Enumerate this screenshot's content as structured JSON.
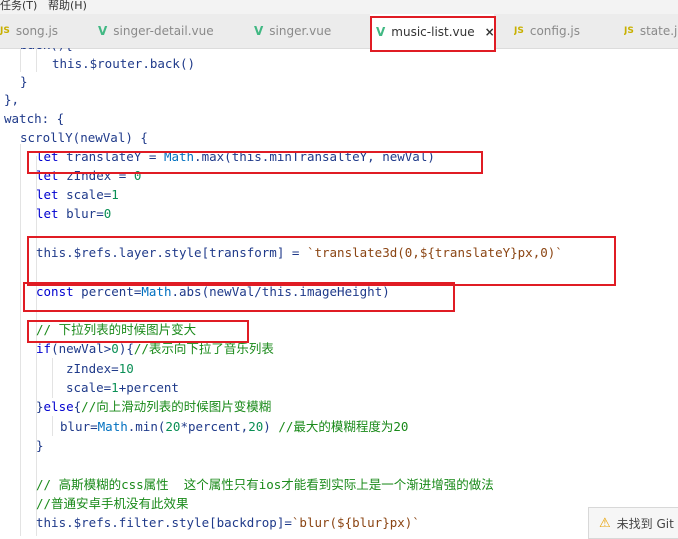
{
  "menu": {
    "items": [
      "任务(T)",
      "帮助(H)"
    ]
  },
  "tabs": [
    {
      "icon": "js-icon",
      "icon_text": "JS",
      "label": "song.js"
    },
    {
      "icon": "vue-icon",
      "icon_text": "V",
      "label": "singer-detail.vue"
    },
    {
      "icon": "vue-icon",
      "icon_text": "V",
      "label": "singer.vue"
    },
    {
      "icon": "vue-icon",
      "icon_text": "V",
      "label": "music-list.vue",
      "close": "×"
    },
    {
      "icon": "js-icon",
      "icon_text": "JS",
      "label": "config.js"
    },
    {
      "icon": "js-icon",
      "icon_text": "JS",
      "label": "state.js"
    }
  ],
  "code": {
    "lines": [
      [
        [
          "plain",
          "back(){"
        ]
      ],
      [
        [
          "plain",
          "this"
        ],
        [
          "plain",
          ".$router.back()"
        ]
      ],
      [
        [
          "plain",
          "}"
        ]
      ],
      [
        [
          "plain",
          "},"
        ]
      ],
      [
        [
          "plain",
          "watch: {"
        ]
      ],
      [
        [
          "plain",
          "scrollY(newVal) {"
        ]
      ],
      [
        [
          "kw",
          "let"
        ],
        [
          "plain",
          " translateY = "
        ],
        [
          "obj",
          "Math"
        ],
        [
          "plain",
          ".max("
        ],
        [
          "plain",
          "this"
        ],
        [
          "plain",
          ".minTransalteY, newVal)"
        ]
      ],
      [
        [
          "kw",
          "let"
        ],
        [
          "plain",
          " zIndex = "
        ],
        [
          "num",
          "0"
        ]
      ],
      [
        [
          "kw",
          "let"
        ],
        [
          "plain",
          " scale="
        ],
        [
          "num",
          "1"
        ]
      ],
      [
        [
          "kw",
          "let"
        ],
        [
          "plain",
          " blur="
        ],
        [
          "num",
          "0"
        ]
      ],
      [],
      [
        [
          "plain",
          "this"
        ],
        [
          "plain",
          ".$refs.layer.style[transform] = "
        ],
        [
          "str",
          "`translate3d(0,${translateY}px,0)`"
        ]
      ],
      [],
      [
        [
          "kw",
          "const"
        ],
        [
          "plain",
          " percent="
        ],
        [
          "obj",
          "Math"
        ],
        [
          "plain",
          ".abs(newVal/"
        ],
        [
          "plain",
          "this"
        ],
        [
          "plain",
          ".imageHeight)"
        ]
      ],
      [],
      [
        [
          "cm",
          "// 下拉列表的时候图片变大"
        ]
      ],
      [
        [
          "kw",
          "if"
        ],
        [
          "plain",
          "(newVal>"
        ],
        [
          "num",
          "0"
        ],
        [
          "plain",
          "){"
        ],
        [
          "cm",
          "//表示向下拉了音乐列表"
        ]
      ],
      [
        [
          "plain",
          "zIndex="
        ],
        [
          "num",
          "10"
        ]
      ],
      [
        [
          "plain",
          "scale="
        ],
        [
          "num",
          "1"
        ],
        [
          "plain",
          "+percent"
        ]
      ],
      [
        [
          "plain",
          "}"
        ],
        [
          "kw",
          "else"
        ],
        [
          "plain",
          "{"
        ],
        [
          "cm",
          "//向上滑动列表的时候图片变模糊"
        ]
      ],
      [
        [
          "plain",
          "blur="
        ],
        [
          "obj",
          "Math"
        ],
        [
          "plain",
          ".min("
        ],
        [
          "num",
          "20"
        ],
        [
          "plain",
          "*percent,"
        ],
        [
          "num",
          "20"
        ],
        [
          "plain",
          ") "
        ],
        [
          "cm",
          "//最大的模糊程度为20"
        ]
      ],
      [
        [
          "plain",
          "}"
        ]
      ],
      [],
      [
        [
          "cm",
          "// 高斯模糊的css属性  这个属性只有ios才能看到实际上是一个渐进增强的做法"
        ]
      ],
      [
        [
          "cm",
          "//普通安卓手机没有此效果"
        ]
      ],
      [
        [
          "plain",
          "this"
        ],
        [
          "plain",
          ".$refs.filter.style[backdrop]="
        ],
        [
          "str",
          "`blur(${blur}px)`"
        ]
      ]
    ]
  },
  "notification": {
    "text": "未找到 Git"
  }
}
